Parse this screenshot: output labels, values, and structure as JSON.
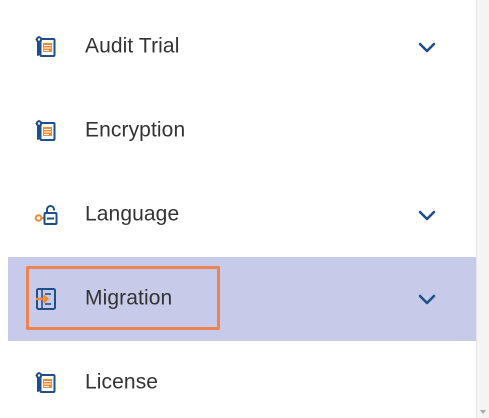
{
  "menu": {
    "items": [
      {
        "label": "Audit Trial",
        "icon": "audit-document-icon",
        "has_chevron": true,
        "active": false
      },
      {
        "label": "Encryption",
        "icon": "encryption-document-icon",
        "has_chevron": false,
        "active": false
      },
      {
        "label": "Language",
        "icon": "language-key-icon",
        "has_chevron": true,
        "active": false
      },
      {
        "label": "Migration",
        "icon": "migration-import-icon",
        "has_chevron": true,
        "active": true
      },
      {
        "label": "License",
        "icon": "license-document-icon",
        "has_chevron": false,
        "active": false
      }
    ]
  },
  "colors": {
    "active_background": "#c7cbe9",
    "highlight_border": "#ee8250",
    "text": "#333333",
    "icon_blue": "#1f4f8a",
    "icon_orange": "#f08a36"
  }
}
